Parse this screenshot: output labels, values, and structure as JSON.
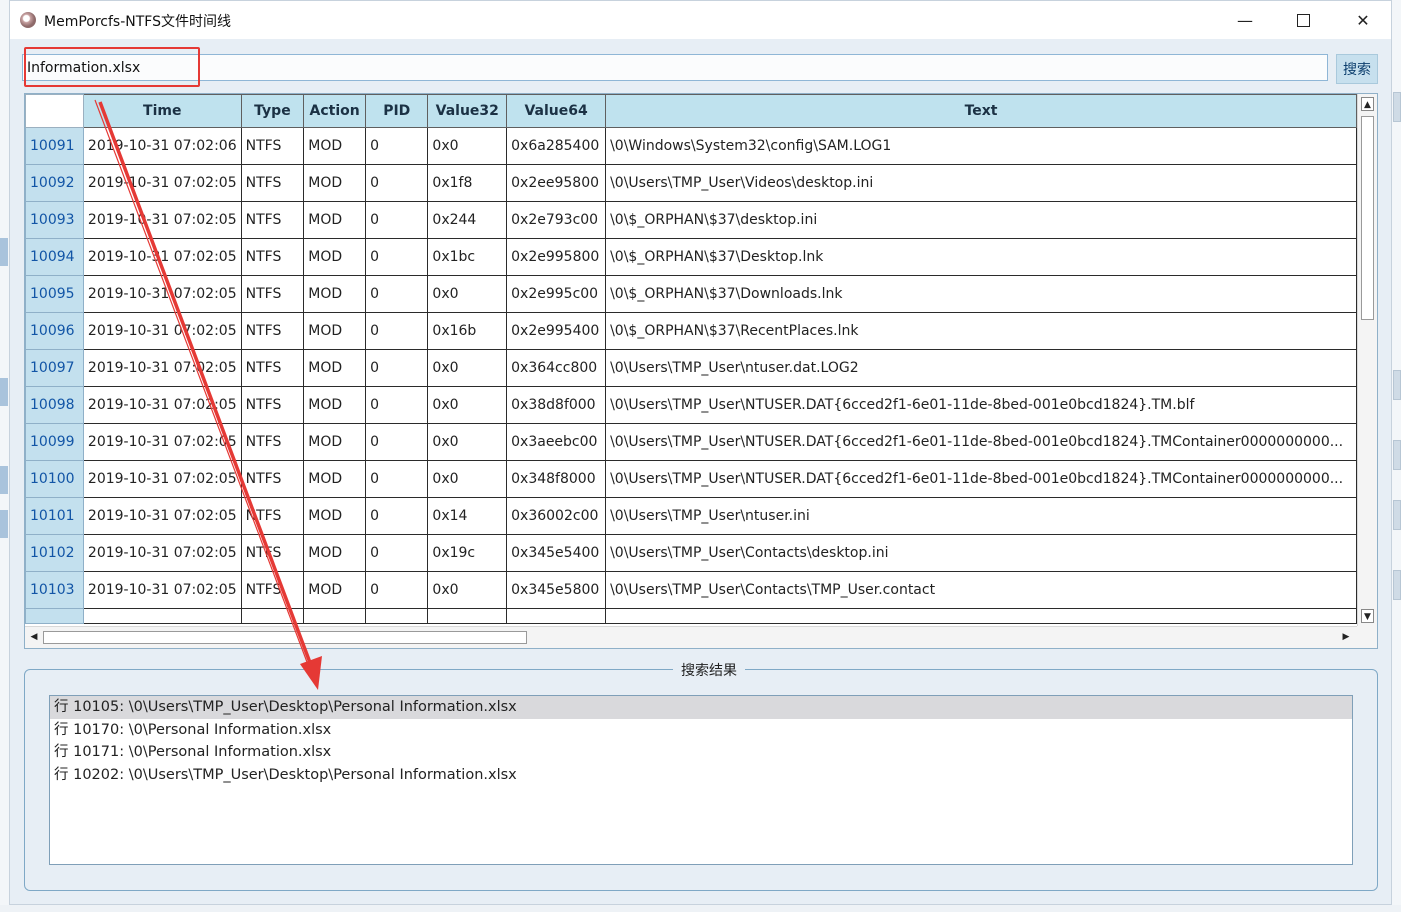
{
  "window": {
    "title": "MemPorcfs-NTFS文件时间线"
  },
  "controls": {
    "minimize": "—",
    "close": "✕"
  },
  "search": {
    "value": "Information.xlsx",
    "button_label": "搜索"
  },
  "grid": {
    "columns": [
      "Time",
      "Type",
      "Action",
      "PID",
      "Value32",
      "Value64",
      "Text"
    ],
    "rows": [
      {
        "id": "10091",
        "time": "2019-10-31 07:02:06",
        "type": "NTFS",
        "action": "MOD",
        "pid": "0",
        "v32": "0x0",
        "v64": "0x6a285400",
        "text": "\\0\\Windows\\System32\\config\\SAM.LOG1"
      },
      {
        "id": "10092",
        "time": "2019-10-31 07:02:05",
        "type": "NTFS",
        "action": "MOD",
        "pid": "0",
        "v32": "0x1f8",
        "v64": "0x2ee95800",
        "text": "\\0\\Users\\TMP_User\\Videos\\desktop.ini"
      },
      {
        "id": "10093",
        "time": "2019-10-31 07:02:05",
        "type": "NTFS",
        "action": "MOD",
        "pid": "0",
        "v32": "0x244",
        "v64": "0x2e793c00",
        "text": "\\0\\$_ORPHAN\\$37\\desktop.ini"
      },
      {
        "id": "10094",
        "time": "2019-10-31 07:02:05",
        "type": "NTFS",
        "action": "MOD",
        "pid": "0",
        "v32": "0x1bc",
        "v64": "0x2e995800",
        "text": "\\0\\$_ORPHAN\\$37\\Desktop.lnk"
      },
      {
        "id": "10095",
        "time": "2019-10-31 07:02:05",
        "type": "NTFS",
        "action": "MOD",
        "pid": "0",
        "v32": "0x0",
        "v64": "0x2e995c00",
        "text": "\\0\\$_ORPHAN\\$37\\Downloads.lnk"
      },
      {
        "id": "10096",
        "time": "2019-10-31 07:02:05",
        "type": "NTFS",
        "action": "MOD",
        "pid": "0",
        "v32": "0x16b",
        "v64": "0x2e995400",
        "text": "\\0\\$_ORPHAN\\$37\\RecentPlaces.lnk"
      },
      {
        "id": "10097",
        "time": "2019-10-31 07:02:05",
        "type": "NTFS",
        "action": "MOD",
        "pid": "0",
        "v32": "0x0",
        "v64": "0x364cc800",
        "text": "\\0\\Users\\TMP_User\\ntuser.dat.LOG2"
      },
      {
        "id": "10098",
        "time": "2019-10-31 07:02:05",
        "type": "NTFS",
        "action": "MOD",
        "pid": "0",
        "v32": "0x0",
        "v64": "0x38d8f000",
        "text": "\\0\\Users\\TMP_User\\NTUSER.DAT{6cced2f1-6e01-11de-8bed-001e0bcd1824}.TM.blf"
      },
      {
        "id": "10099",
        "time": "2019-10-31 07:02:05",
        "type": "NTFS",
        "action": "MOD",
        "pid": "0",
        "v32": "0x0",
        "v64": "0x3aeebc00",
        "text": "\\0\\Users\\TMP_User\\NTUSER.DAT{6cced2f1-6e01-11de-8bed-001e0bcd1824}.TMContainer0000000000..."
      },
      {
        "id": "10100",
        "time": "2019-10-31 07:02:05",
        "type": "NTFS",
        "action": "MOD",
        "pid": "0",
        "v32": "0x0",
        "v64": "0x348f8000",
        "text": "\\0\\Users\\TMP_User\\NTUSER.DAT{6cced2f1-6e01-11de-8bed-001e0bcd1824}.TMContainer0000000000..."
      },
      {
        "id": "10101",
        "time": "2019-10-31 07:02:05",
        "type": "NTFS",
        "action": "MOD",
        "pid": "0",
        "v32": "0x14",
        "v64": "0x36002c00",
        "text": "\\0\\Users\\TMP_User\\ntuser.ini"
      },
      {
        "id": "10102",
        "time": "2019-10-31 07:02:05",
        "type": "NTFS",
        "action": "MOD",
        "pid": "0",
        "v32": "0x19c",
        "v64": "0x345e5400",
        "text": "\\0\\Users\\TMP_User\\Contacts\\desktop.ini"
      },
      {
        "id": "10103",
        "time": "2019-10-31 07:02:05",
        "type": "NTFS",
        "action": "MOD",
        "pid": "0",
        "v32": "0x0",
        "v64": "0x345e5800",
        "text": "\\0\\Users\\TMP_User\\Contacts\\TMP_User.contact"
      }
    ]
  },
  "results": {
    "legend": "搜索结果",
    "items": [
      "行 10105: \\0\\Users\\TMP_User\\Desktop\\Personal Information.xlsx",
      "行 10170: \\0\\Personal Information.xlsx",
      "行 10171: \\0\\Personal Information.xlsx",
      "行 10202: \\0\\Users\\TMP_User\\Desktop\\Personal Information.xlsx"
    ],
    "selected_index": 0
  },
  "colors": {
    "annotation": "#e53935",
    "header": "#bfe2ee",
    "row_header_text": "#1255a6"
  }
}
